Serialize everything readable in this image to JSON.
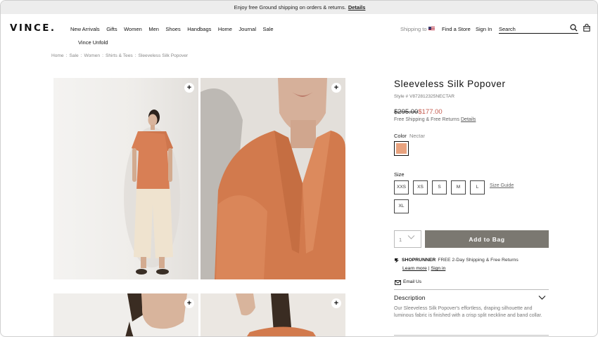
{
  "promo": {
    "text": "Enjoy free Ground shipping on orders & returns.",
    "link": "Details"
  },
  "header": {
    "logo": "VINCE.",
    "nav": [
      "New Arrivals",
      "Gifts",
      "Women",
      "Men",
      "Shoes",
      "Handbags",
      "Home",
      "Journal",
      "Sale"
    ],
    "nav_second_row": "Vince Unfold",
    "shipping_to": "Shipping to",
    "find_store": "Find a Store",
    "sign_in": "Sign In",
    "search_placeholder": "Search",
    "icons": {
      "search": "search-icon",
      "bag": "shopping-bag-icon",
      "flag": "us-flag-icon"
    }
  },
  "breadcrumb": [
    "Home",
    "Sale",
    "Women",
    "Shirts & Tees",
    "Sleeveless Silk Popover"
  ],
  "breadcrumb_separator": ":",
  "gallery": {
    "zoom_symbol": "+"
  },
  "product": {
    "title": "Sleeveless Silk Popover",
    "style": "Style # V872812325NECTAR",
    "original_price": "$295.00",
    "sale_price": "$177.00",
    "shipping_note": "Free Shipping & Free Returns",
    "shipping_details_link": "Details",
    "color_label": "Color",
    "color_value": "Nectar",
    "swatch_color": "#e8a27e",
    "size_label": "Size",
    "sizes": [
      "XXS",
      "XS",
      "S",
      "M",
      "L",
      "XL"
    ],
    "size_guide": "Size Guide",
    "quantity": "1",
    "add_to_bag": "Add to Bag",
    "button_color": "#7b7871",
    "sale_price_color": "#c35a4e"
  },
  "shoprunner": {
    "brand": "SHOPRUNNER",
    "text": "FREE 2-Day Shipping & Free Returns",
    "learn_more": "Learn more",
    "separator": "|",
    "sign_in": "Sign in"
  },
  "email_us": "Email Us",
  "description": {
    "title": "Description",
    "text": "Our Sleeveless Silk Popover's effortless, draping silhouette and luminous fabric is finished with a crisp split neckline and band collar."
  }
}
